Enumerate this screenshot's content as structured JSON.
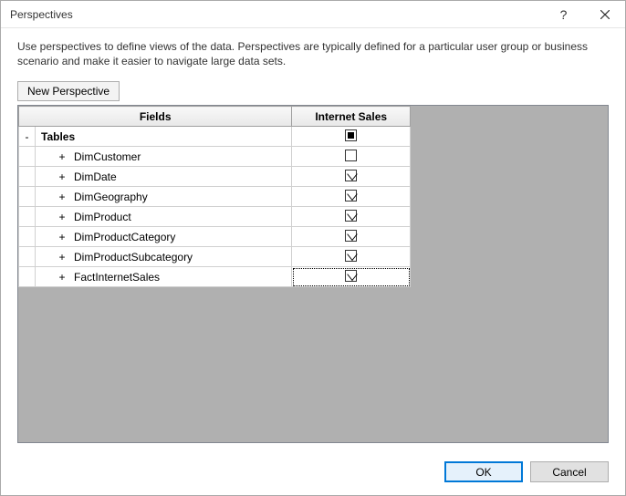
{
  "window": {
    "title": "Perspectives"
  },
  "description": "Use perspectives to define views of the data. Perspectives are typically defined for a particular user group or business scenario and make it easier to navigate large data sets.",
  "buttons": {
    "new_perspective": "New Perspective",
    "ok": "OK",
    "cancel": "Cancel"
  },
  "grid": {
    "headers": {
      "fields": "Fields",
      "perspective": "Internet Sales"
    },
    "root_label": "Tables",
    "root_expander": "-",
    "root_state": "indeterminate",
    "rows": [
      {
        "expander": "+",
        "label": "DimCustomer",
        "checked": false
      },
      {
        "expander": "+",
        "label": "DimDate",
        "checked": true
      },
      {
        "expander": "+",
        "label": "DimGeography",
        "checked": true
      },
      {
        "expander": "+",
        "label": "DimProduct",
        "checked": true
      },
      {
        "expander": "+",
        "label": "DimProductCategory",
        "checked": true
      },
      {
        "expander": "+",
        "label": "DimProductSubcategory",
        "checked": true
      },
      {
        "expander": "+",
        "label": "FactInternetSales",
        "checked": true,
        "focused": true
      }
    ]
  }
}
